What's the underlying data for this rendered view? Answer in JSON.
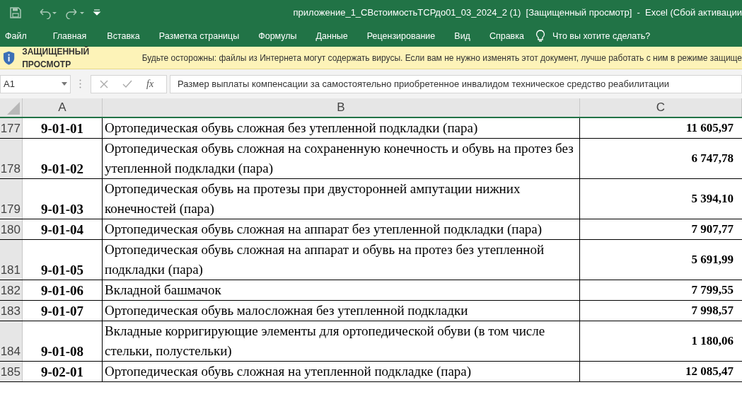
{
  "window": {
    "title": "приложение_1_СВстоимостьТСРдо01_03_2024_2 (1)  [Защищенный просмотр]  -  Excel (Сбой активации"
  },
  "ribbon_tabs": [
    {
      "label": "Файл"
    },
    {
      "label": "Главная"
    },
    {
      "label": "Вставка"
    },
    {
      "label": "Разметка страницы"
    },
    {
      "label": "Формулы"
    },
    {
      "label": "Данные"
    },
    {
      "label": "Рецензирование"
    },
    {
      "label": "Вид"
    },
    {
      "label": "Справка"
    }
  ],
  "tell_me": {
    "placeholder": "Что вы хотите сделать?"
  },
  "protected_view": {
    "label": "ЗАЩИЩЕННЫЙ ПРОСМОТР",
    "message": "Будьте осторожны: файлы из Интернета могут содержать вирусы. Если вам не нужно изменять этот документ, лучше работать с ним в режиме защище"
  },
  "formula_bar": {
    "name_box": "A1",
    "fx": "fx",
    "value": "Размер выплаты компенсации за самостоятельно приобретенное инвалидом техническое средство реабилитации"
  },
  "table": {
    "columns": [
      "A",
      "B",
      "C"
    ],
    "rows": [
      {
        "row": "177",
        "code": "9-01-01",
        "name": "Ортопедическая обувь сложная без утепленной подкладки (пара)",
        "price": "11 605,97"
      },
      {
        "row": "178",
        "code": "9-01-02",
        "name": "Ортопедическая обувь сложная на сохраненную конечность и обувь на протез без утепленной подкладки (пара)",
        "price": "6 747,78"
      },
      {
        "row": "179",
        "code": "9-01-03",
        "name": "Ортопедическая обувь на протезы при двусторонней ампутации нижних конечностей (пара)",
        "price": "5 394,10"
      },
      {
        "row": "180",
        "code": "9-01-04",
        "name": "Ортопедическая обувь сложная на аппарат без утепленной подкладки (пара)",
        "price": "7 907,77"
      },
      {
        "row": "181",
        "code": "9-01-05",
        "name": "Ортопедическая обувь сложная на аппарат и обувь на протез без утепленной подкладки (пара)",
        "price": "5 691,99"
      },
      {
        "row": "182",
        "code": "9-01-06",
        "name": "Вкладной башмачок",
        "price": "7 799,55"
      },
      {
        "row": "183",
        "code": "9-01-07",
        "name": "Ортопедическая обувь малосложная без утепленной подкладки",
        "price": "7 998,57"
      },
      {
        "row": "184",
        "code": "9-01-08",
        "name": "Вкладные корригирующие элементы для ортопедической обуви (в том числе стельки, полустельки)",
        "price": "1 180,06"
      },
      {
        "row": "185",
        "code": "9-02-01",
        "name": "Ортопедическая обувь сложная на утепленной подкладке (пара)",
        "price": "12 085,47"
      }
    ]
  }
}
